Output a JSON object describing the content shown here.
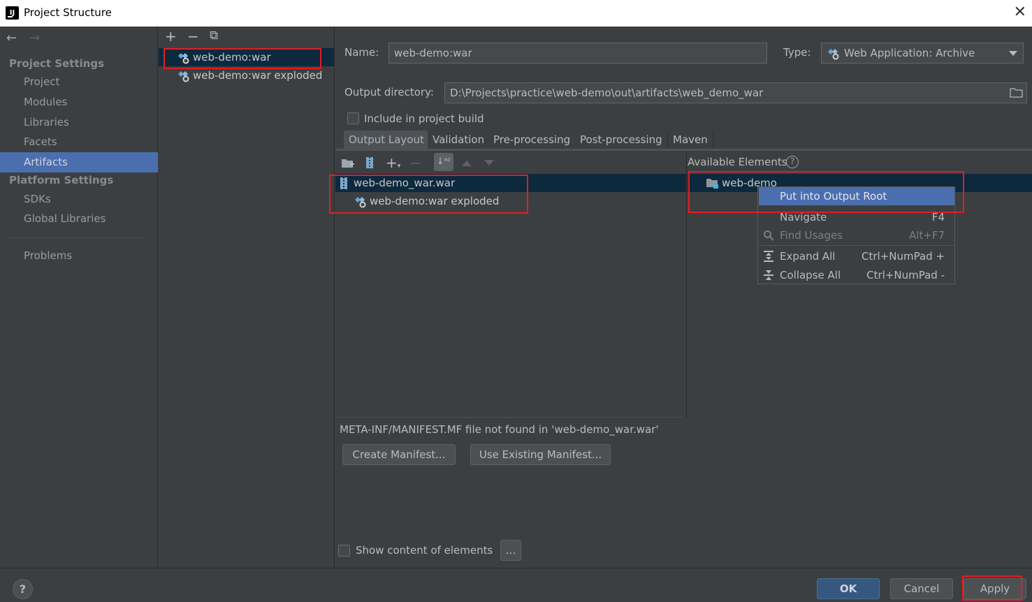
{
  "window": {
    "title": "Project Structure",
    "close_glyph": "✕"
  },
  "nav": {
    "back": "←",
    "forward": "→",
    "project_settings_header": "Project Settings",
    "project_settings": [
      "Project",
      "Modules",
      "Libraries",
      "Facets",
      "Artifacts"
    ],
    "platform_settings_header": "Platform Settings",
    "platform_settings": [
      "SDKs",
      "Global Libraries"
    ],
    "problems": "Problems",
    "selected": "Artifacts"
  },
  "artifacts": {
    "toolbar": {
      "add": "+",
      "remove": "−",
      "copy": "⧉"
    },
    "items": [
      "web-demo:war",
      "web-demo:war exploded"
    ],
    "selected": "web-demo:war"
  },
  "detail": {
    "name_label": "Name:",
    "name_value": "web-demo:war",
    "type_label": "Type:",
    "type_value": "Web Application: Archive",
    "output_dir_label": "Output directory:",
    "output_dir_value": "D:\\Projects\\practice\\web-demo\\out\\artifacts\\web_demo_war",
    "include_in_build": "Include in project build",
    "tabs": [
      "Output Layout",
      "Validation",
      "Pre-processing",
      "Post-processing",
      "Maven"
    ],
    "selected_tab": "Output Layout",
    "layout_tree": {
      "root": "web-demo_war.war",
      "child": "web-demo:war exploded"
    },
    "available_elements_label": "Available Elements",
    "available_elements": [
      "web-demo"
    ],
    "manifest_message": "META-INF/MANIFEST.MF file not found in 'web-demo_war.war'",
    "create_manifest": "Create Manifest...",
    "use_existing_manifest": "Use Existing Manifest...",
    "show_content": "Show content of elements",
    "ellipsis": "..."
  },
  "context_menu": {
    "items": [
      {
        "label": "Put into Output Root",
        "shortcut": ""
      },
      {
        "label": "Navigate",
        "shortcut": "F4"
      },
      {
        "label": "Find Usages",
        "shortcut": "Alt+F7"
      },
      {
        "label": "Expand All",
        "shortcut": "Ctrl+NumPad +"
      },
      {
        "label": "Collapse All",
        "shortcut": "Ctrl+NumPad -"
      }
    ],
    "highlighted": "Put into Output Root"
  },
  "footer": {
    "help": "?",
    "ok": "OK",
    "cancel": "Cancel",
    "apply": "Apply"
  },
  "colors": {
    "background": "#3c3f41",
    "selection": "#4b6eaf",
    "annotation_red": "#e51c23"
  }
}
